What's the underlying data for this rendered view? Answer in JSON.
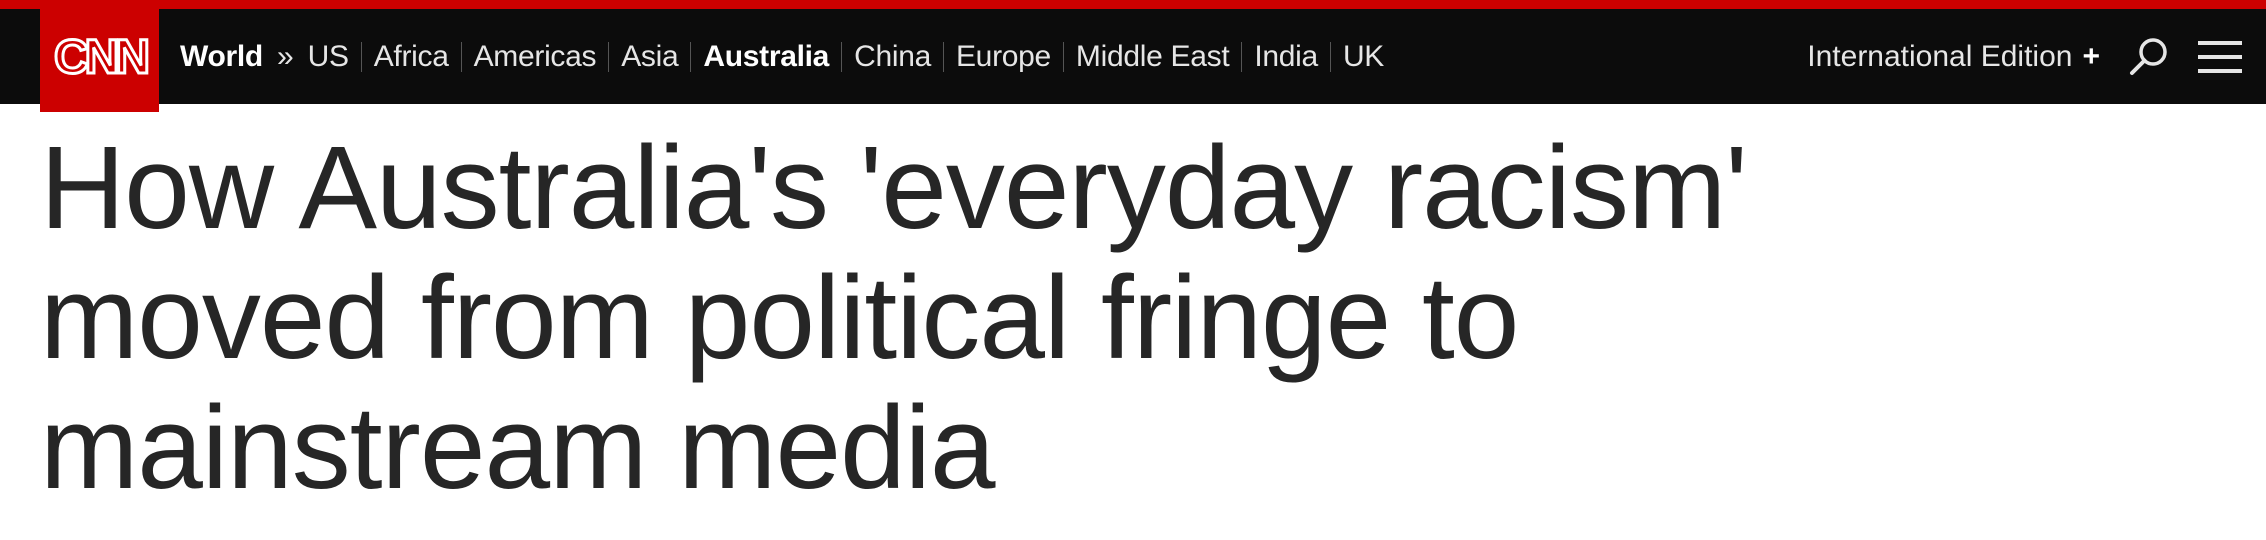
{
  "brand": {
    "logo_text": "CNN",
    "accent_color": "#cc0000",
    "nav_background": "#0c0c0c"
  },
  "nav": {
    "section": "World",
    "chevron": "»",
    "items": [
      {
        "label": "US",
        "active": false
      },
      {
        "label": "Africa",
        "active": false
      },
      {
        "label": "Americas",
        "active": false
      },
      {
        "label": "Asia",
        "active": false
      },
      {
        "label": "Australia",
        "active": true
      },
      {
        "label": "China",
        "active": false
      },
      {
        "label": "Europe",
        "active": false
      },
      {
        "label": "Middle East",
        "active": false
      },
      {
        "label": "India",
        "active": false
      },
      {
        "label": "UK",
        "active": false
      }
    ]
  },
  "edition": {
    "label": "International Edition",
    "plus": "+"
  },
  "icons": {
    "search": "search-icon",
    "menu": "hamburger-menu-icon"
  },
  "article": {
    "headline": "How Australia's 'everyday racism' moved from political fringe to mainstream media"
  }
}
